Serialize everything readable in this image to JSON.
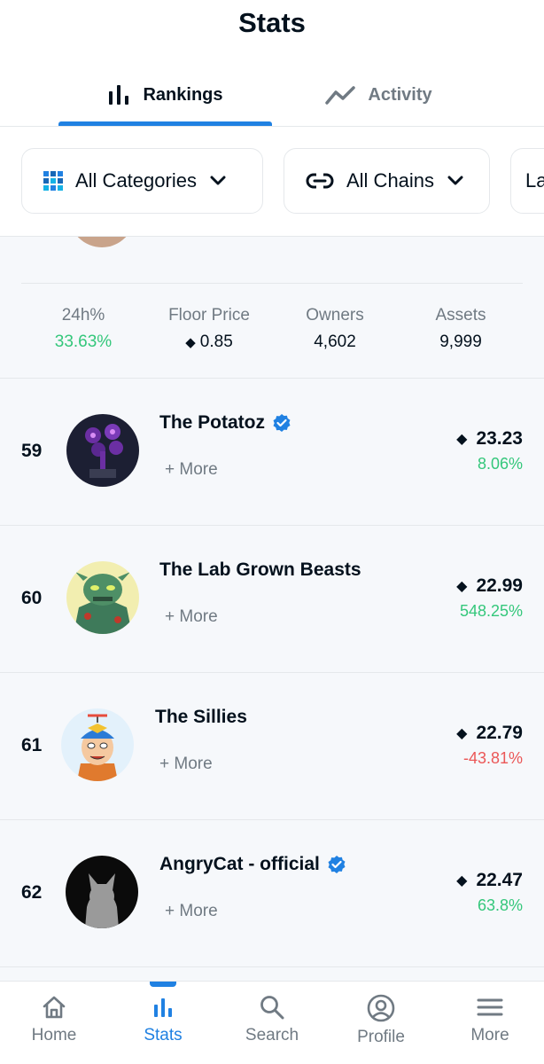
{
  "header": {
    "title": "Stats"
  },
  "tabs": [
    {
      "label": "Rankings",
      "icon": "bar-chart-icon",
      "active": true
    },
    {
      "label": "Activity",
      "icon": "trend-line-icon",
      "active": false
    }
  ],
  "filters": [
    {
      "label": "All Categories",
      "icon": "grid-icon"
    },
    {
      "label": "All Chains",
      "icon": "link-icon"
    },
    {
      "label": "La"
    }
  ],
  "expanded_stats": {
    "change_label": "24h%",
    "change_value": "33.63%",
    "floor_label": "Floor Price",
    "floor_value": "0.85",
    "owners_label": "Owners",
    "owners_value": "4,602",
    "assets_label": "Assets",
    "assets_value": "9,999"
  },
  "rows": [
    {
      "rank": "59",
      "name": "The Potatoz",
      "verified": true,
      "more": "+ More",
      "price": "23.23",
      "change": "8.06%",
      "trend": "up"
    },
    {
      "rank": "60",
      "name": "The Lab Grown Beasts",
      "verified": false,
      "more": "+ More",
      "price": "22.99",
      "change": "548.25%",
      "trend": "up"
    },
    {
      "rank": "61",
      "name": "The Sillies",
      "verified": false,
      "more": "+ More",
      "price": "22.79",
      "change": "-43.81%",
      "trend": "down"
    },
    {
      "rank": "62",
      "name": "AngryCat - official",
      "verified": true,
      "more": "+ More",
      "price": "22.47",
      "change": "63.8%",
      "trend": "up"
    }
  ],
  "nav": [
    {
      "label": "Home",
      "icon": "home-icon"
    },
    {
      "label": "Stats",
      "icon": "stats-icon",
      "active": true
    },
    {
      "label": "Search",
      "icon": "search-icon"
    },
    {
      "label": "Profile",
      "icon": "profile-icon"
    },
    {
      "label": "More",
      "icon": "menu-icon"
    }
  ],
  "colors": {
    "accent": "#2081e2",
    "positive": "#34c77b",
    "negative": "#eb5757",
    "text": "#04111d",
    "muted": "#707a83"
  }
}
